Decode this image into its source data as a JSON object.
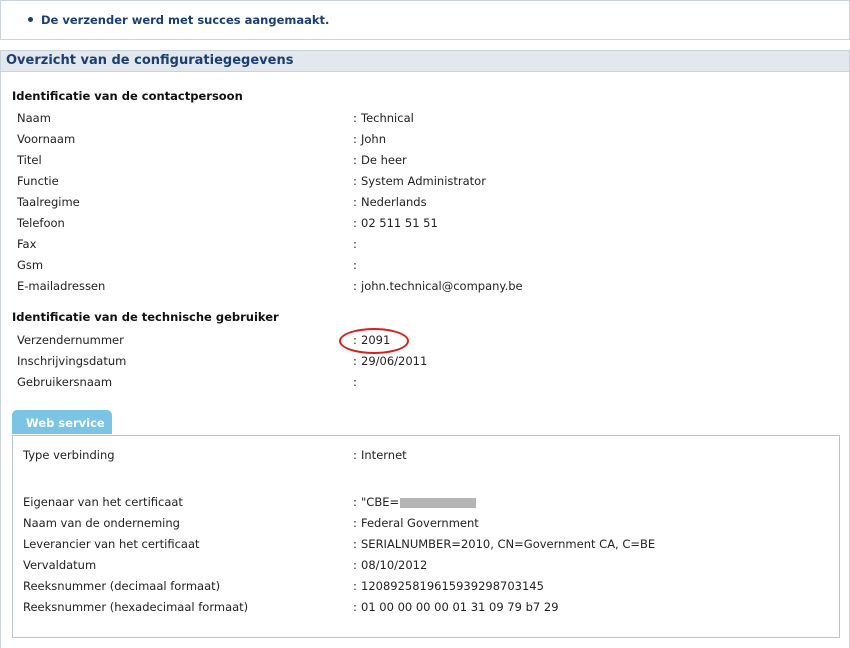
{
  "notice": {
    "message": "De verzender werd met succes aangemaakt."
  },
  "panel": {
    "title": "Overzicht van de configuratiegegevens"
  },
  "contact": {
    "title": "Identificatie van de contactpersoon",
    "rows": [
      {
        "label": "Naam",
        "value": "Technical"
      },
      {
        "label": "Voornaam",
        "value": "John"
      },
      {
        "label": "Titel",
        "value": "De heer"
      },
      {
        "label": "Functie",
        "value": "System Administrator"
      },
      {
        "label": "Taalregime",
        "value": "Nederlands"
      },
      {
        "label": "Telefoon",
        "value": "02 511 51 51"
      },
      {
        "label": "Fax",
        "value": ""
      },
      {
        "label": "Gsm",
        "value": ""
      },
      {
        "label": "E-mailadressen",
        "value": "john.technical@company.be"
      }
    ]
  },
  "technical": {
    "title": "Identificatie van de technische gebruiker",
    "rows": [
      {
        "label": "Verzendernummer",
        "value": "2091"
      },
      {
        "label": "Inschrijvingsdatum",
        "value": "29/06/2011"
      },
      {
        "label": "Gebruikersnaam",
        "value": ""
      }
    ]
  },
  "webservice": {
    "tab_label": "Web service",
    "rows": [
      {
        "label": "Type verbinding",
        "value": "Internet"
      },
      {
        "label": "Eigenaar van het certificaat",
        "value": "\"CBE="
      },
      {
        "label": "Naam van de onderneming",
        "value": "Federal Government"
      },
      {
        "label": "Leverancier van het certificaat",
        "value": "SERIALNUMBER=2010, CN=Government CA, C=BE"
      },
      {
        "label": "Vervaldatum",
        "value": "08/10/2012"
      },
      {
        "label": "Reeksnummer (decimaal formaat)",
        "value": "120892581961593929870314­5"
      },
      {
        "label": "Reeksnummer (hexadecimaal formaat)",
        "value": "01 00 00 00 00 01 31 09 79 b7 29"
      }
    ]
  },
  "colors": {
    "accent": "#1b3f72",
    "tab": "#7cc4e3",
    "highlight": "#d42020"
  }
}
